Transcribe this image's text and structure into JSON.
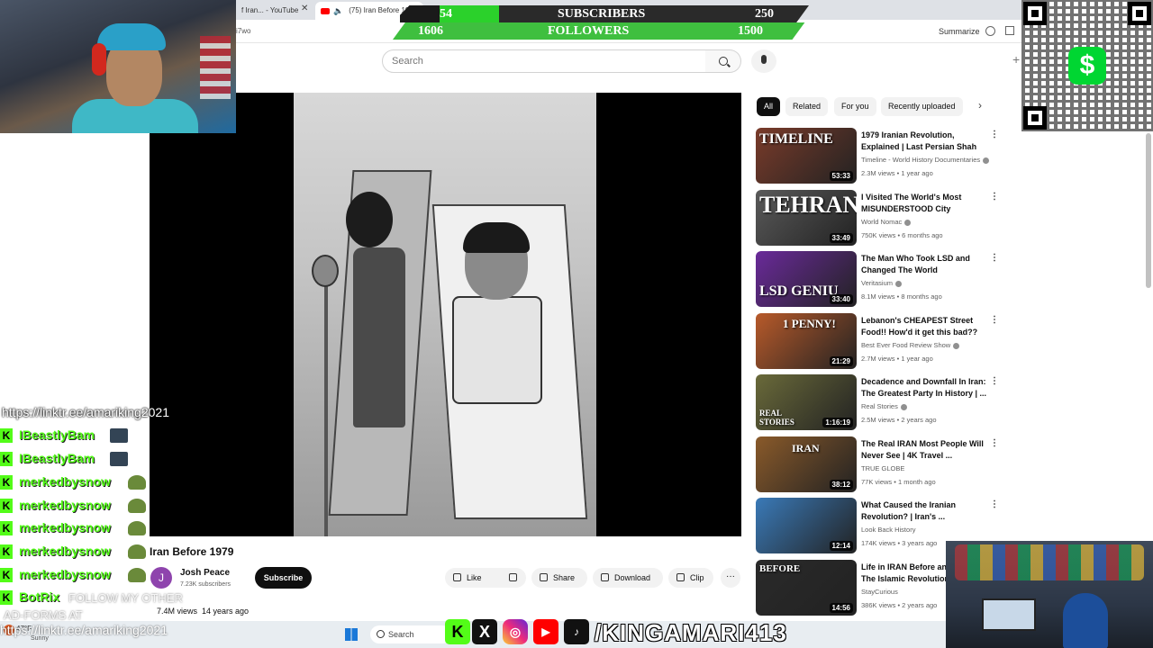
{
  "browser": {
    "tabs": [
      {
        "label": "f Iran... - YouTube"
      },
      {
        "label": "(75) Iran Before 1979"
      }
    ],
    "address_fragment": "i7wo",
    "summarize_label": "Summarize"
  },
  "stream_stats": {
    "subscribers_current": "54",
    "subscribers_label": "SUBSCRIBERS",
    "subscribers_goal": "250",
    "followers_current": "1606",
    "followers_label": "FOLLOWERS",
    "followers_goal": "1500"
  },
  "search": {
    "placeholder": "Search"
  },
  "video": {
    "title": "Iran Before 1979",
    "channel": "Josh Peace",
    "channel_initial": "J",
    "subscribers": "7.23K subscribers",
    "subscribe_label": "Subscribe",
    "views": "7.4M views",
    "age": "14 years ago",
    "actions": {
      "like": "Like",
      "share": "Share",
      "download": "Download",
      "clip": "Clip",
      "more": "···"
    }
  },
  "chips": [
    "All",
    "Related",
    "For you",
    "Recently uploaded"
  ],
  "recommendations": [
    {
      "title": "1979 Iranian Revolution, Explained | Last Persian Shah",
      "channel": "Timeline - World History Documentaries",
      "verified": true,
      "views": "2.3M views",
      "age": "1 year ago",
      "duration": "53:33",
      "thumb_text": "TIMELINE",
      "thumb_color": "#7a3b2a"
    },
    {
      "title": "I Visited The World's Most MISUNDERSTOOD City",
      "channel": "World Nomac",
      "verified": true,
      "views": "750K views",
      "age": "6 months ago",
      "duration": "33:49",
      "thumb_text": "TEHRAN",
      "thumb_color": "#5a5a5a"
    },
    {
      "title": "The Man Who Took LSD and Changed The World",
      "channel": "Veritasium",
      "verified": true,
      "views": "8.1M views",
      "age": "8 months ago",
      "duration": "33:40",
      "thumb_text": "LSD GENIU",
      "thumb_color": "#6a2a9a"
    },
    {
      "title": "Lebanon's CHEAPEST Street Food!! How'd it get this bad??",
      "channel": "Best Ever Food Review Show",
      "verified": true,
      "views": "2.7M views",
      "age": "1 year ago",
      "duration": "21:29",
      "thumb_text": "1 PENNY!",
      "thumb_color": "#b85a2a"
    },
    {
      "title": "Decadence and Downfall In Iran: The Greatest Party In History | ...",
      "channel": "Real Stories",
      "verified": true,
      "views": "2.5M views",
      "age": "2 years ago",
      "duration": "1:16:19",
      "thumb_text": "REAL STORIES",
      "thumb_color": "#6a6a3a"
    },
    {
      "title": "The Real IRAN Most People Will Never See | 4K Travel ...",
      "channel": "TRUE GLOBE",
      "verified": false,
      "views": "77K views",
      "age": "1 month ago",
      "duration": "38:12",
      "thumb_text": "IRAN",
      "thumb_color": "#8a5a2a"
    },
    {
      "title": "What Caused the Iranian Revolution? | Iran's ...",
      "channel": "Look Back History",
      "verified": false,
      "views": "174K views",
      "age": "3 years ago",
      "duration": "12:14",
      "thumb_text": "",
      "thumb_color": "#3a7ab8"
    },
    {
      "title": "Life in IRAN Before and After The Islamic Revolution",
      "channel": "StayCurious",
      "verified": false,
      "views": "386K views",
      "age": "2 years ago",
      "duration": "14:56",
      "thumb_text": "BEFORE",
      "thumb_color": "#2a2a2a"
    }
  ],
  "chat": {
    "link": "https://linktr.ee/amariking2021",
    "messages": [
      {
        "user": "IBeastlyBam"
      },
      {
        "user": "IBeastlyBam"
      },
      {
        "user": "merkedbysnow"
      },
      {
        "user": "merkedbysnow"
      },
      {
        "user": "merkedbysnow"
      },
      {
        "user": "merkedbysnow"
      },
      {
        "user": "merkedbysnow"
      },
      {
        "user": "BotRix"
      }
    ],
    "faded_1": "FOLLOW MY OTHER",
    "faded_2": "AD-FORMS AT"
  },
  "taskbar": {
    "weather_temp": "47°F",
    "weather_desc": "Sunny",
    "search_label": "Search",
    "bottom_link": "https://linktr.ee/amariking2021"
  },
  "social": {
    "kick": "K",
    "x": "X",
    "insta": "◎",
    "yt": "▶",
    "tiktok": "♪",
    "handle": "/KINGAMARI413"
  },
  "cashapp_symbol": "$",
  "icons": [
    "search-icon",
    "mic-icon",
    "like-icon",
    "dislike-icon",
    "share-icon",
    "download-icon",
    "clip-icon",
    "more-icon",
    "cashapp-icon",
    "qr-code"
  ]
}
